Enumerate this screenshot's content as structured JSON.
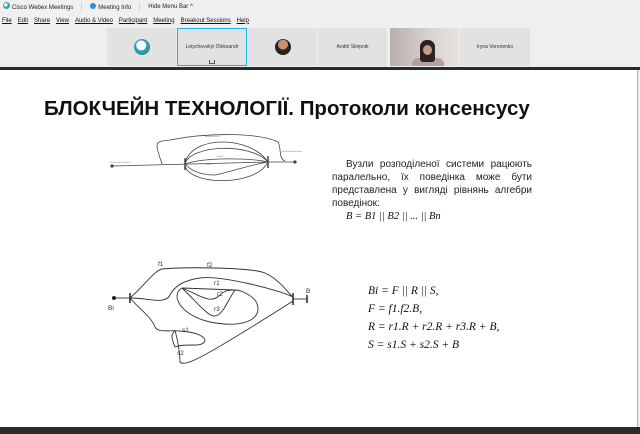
{
  "app": {
    "title": "Cisco Webex Meetings",
    "meeting_info": "Meeting Info",
    "hide_menu": "Hide Menu Bar ^"
  },
  "menu": [
    "File",
    "Edit",
    "Share",
    "View",
    "Audio & Video",
    "Participant",
    "Meeting",
    "Breakout Sessions",
    "Help"
  ],
  "participants": [
    {
      "name": "Letychevskyi Oleksandr"
    },
    {
      "name": "Andrii Skripnik"
    },
    {
      "name": "Iryna Voronenko"
    }
  ],
  "slide": {
    "title": "БЛОКЧЕЙН ТЕХНОЛОГІЇ. Протоколи консенсусу",
    "paragraph": "Вузли розподіленої системи рацюють паралельно, їх поведінка може бути представлена у вигляді рівнянь алгебри поведінок:",
    "formula": "B = B1 || B2 || ... || Bn",
    "diagram1_labels": [
      "NodeFlowStart",
      "Node1",
      "Node2",
      "Node3",
      "Node4",
      "Node5",
      "StartPointProtokolure",
      "EndPointProtokolure"
    ],
    "diagram2_labels": {
      "f1": "f1",
      "f2": "f2",
      "r1": "r1",
      "r2": "r2",
      "r3": "r3",
      "s1": "s1",
      "s2": "s2",
      "bi": "Bi",
      "b": "B"
    },
    "equations": [
      "Bi = F || R || S,",
      "F = f1.f2.B,",
      "R = r1.R + r2.R + r3.R + B,",
      "S = s1.S + s2.S + B"
    ]
  },
  "colors": {
    "accent": "#1ab2e8",
    "slide_border": "#e8a070"
  }
}
